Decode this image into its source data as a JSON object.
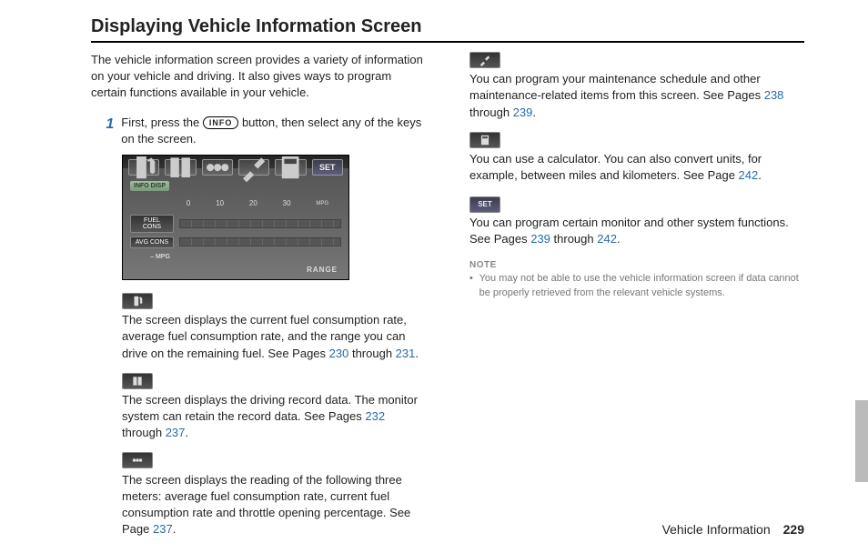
{
  "title": "Displaying Vehicle Information Screen",
  "intro": "The vehicle information screen provides a variety of information on your vehicle and driving. It also gives ways to program certain functions available in your vehicle.",
  "step": {
    "num": "1",
    "pre": "First, press the ",
    "btn": "INFO",
    "post": " button, then select any of the keys on the screen."
  },
  "screenshot": {
    "tabs_set": "SET",
    "info_disp": "INFO DISP",
    "scale": {
      "s0": "0",
      "s10": "10",
      "s20": "20",
      "s30": "30",
      "unit": "MPG"
    },
    "fuel": "FUEL CONS",
    "avg": "AVG CONS",
    "mpg": "– MPG",
    "range": "RANGE"
  },
  "blocks": {
    "fuel": {
      "text_a": "The screen displays the current fuel consumption rate, average fuel consumption rate, and the range you can drive on the remaining fuel. See Pages ",
      "p1": "230",
      "mid": " through ",
      "p2": "231",
      "end": "."
    },
    "record": {
      "text_a": "The screen displays the driving record data. The monitor system can retain the record data. See Pages ",
      "p1": "232",
      "mid": " through ",
      "p2": "237",
      "end": "."
    },
    "meters": {
      "text_a": "The screen displays the reading of the following three meters: average fuel consumption rate, current fuel consumption rate and throttle opening percentage. See Page ",
      "p1": "237",
      "end": "."
    },
    "maint": {
      "text_a": "You can program your maintenance schedule and other maintenance-related items from this screen. See Pages ",
      "p1": "238",
      "mid": " through ",
      "p2": "239",
      "end": "."
    },
    "calc": {
      "text_a": "You can use a calculator. You can also convert units, for example, between miles and kilometers. See Page ",
      "p1": "242",
      "end": "."
    },
    "set": {
      "label": "SET",
      "text_a": "You can program certain monitor and other system functions. See Pages ",
      "p1": "239",
      "mid": " through ",
      "p2": "242",
      "end": "."
    }
  },
  "note": {
    "label": "NOTE",
    "text": "You may not be able to use the vehicle information screen if data cannot be properly retrieved from the relevant vehicle systems."
  },
  "footer": {
    "section": "Vehicle Information",
    "page": "229"
  }
}
